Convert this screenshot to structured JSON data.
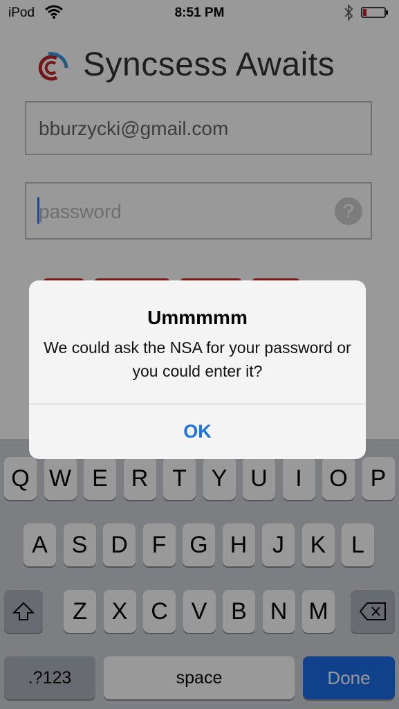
{
  "status_bar": {
    "device": "iPod",
    "time": "8:51 PM"
  },
  "app": {
    "title": "Syncsess Awaits",
    "email_value": "bburzycki@gmail.com",
    "password_placeholder": "password",
    "help_symbol": "?"
  },
  "alert": {
    "title": "Ummmmm",
    "message": "We could ask the NSA for your password or you could enter it?",
    "ok_label": "OK"
  },
  "keyboard": {
    "row1": [
      "Q",
      "W",
      "E",
      "R",
      "T",
      "Y",
      "U",
      "I",
      "O",
      "P"
    ],
    "row2": [
      "A",
      "S",
      "D",
      "F",
      "G",
      "H",
      "J",
      "K",
      "L"
    ],
    "row3": [
      "Z",
      "X",
      "C",
      "V",
      "B",
      "N",
      "M"
    ],
    "numbers_label": ".?123",
    "space_label": "space",
    "done_label": "Done"
  },
  "colors": {
    "accent_blue": "#1a72e8",
    "error_red": "#d22b2b",
    "logo_red": "#c0272d",
    "logo_blue": "#3a9ad9"
  }
}
